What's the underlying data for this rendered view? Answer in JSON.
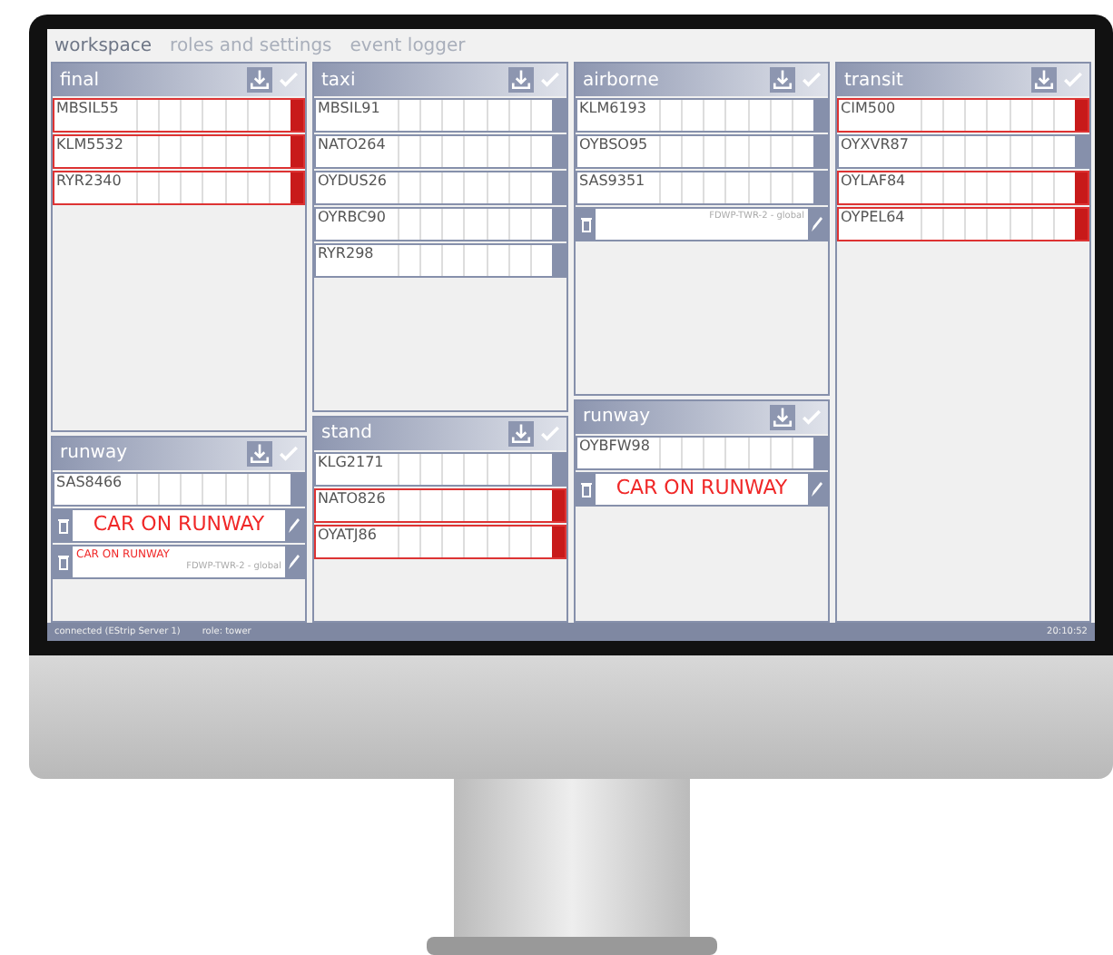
{
  "tabs": [
    {
      "label": "workspace",
      "selected": true
    },
    {
      "label": "roles and settings",
      "selected": false
    },
    {
      "label": "event logger",
      "selected": false
    }
  ],
  "columns": [
    {
      "panels": [
        {
          "title": "final",
          "strips": [
            {
              "kind": "strip",
              "callsign": "MBSIL55",
              "alert": true
            },
            {
              "kind": "strip",
              "callsign": "KLM5532",
              "alert": true
            },
            {
              "kind": "strip",
              "callsign": "RYR2340",
              "alert": true
            }
          ]
        },
        {
          "title": "runway",
          "strips": [
            {
              "kind": "strip",
              "callsign": "SAS8466",
              "alert": false
            },
            {
              "kind": "banner",
              "text": "CAR ON RUNWAY"
            },
            {
              "kind": "note",
              "text": "CAR ON RUNWAY",
              "author": "FDWP-TWR-2 - global"
            }
          ]
        }
      ]
    },
    {
      "panels": [
        {
          "title": "taxi",
          "strips": [
            {
              "kind": "strip",
              "callsign": "MBSIL91",
              "alert": false
            },
            {
              "kind": "strip",
              "callsign": "NATO264",
              "alert": false
            },
            {
              "kind": "strip",
              "callsign": "OYDUS26",
              "alert": false
            },
            {
              "kind": "strip",
              "callsign": "OYRBC90",
              "alert": false
            },
            {
              "kind": "strip",
              "callsign": "RYR298",
              "alert": false
            }
          ]
        },
        {
          "title": "stand",
          "strips": [
            {
              "kind": "strip",
              "callsign": "KLG2171",
              "alert": false
            },
            {
              "kind": "strip",
              "callsign": "NATO826",
              "alert": true
            },
            {
              "kind": "strip",
              "callsign": "OYATJ86",
              "alert": true
            }
          ]
        }
      ]
    },
    {
      "panels": [
        {
          "title": "airborne",
          "strips": [
            {
              "kind": "strip",
              "callsign": "KLM6193",
              "alert": false
            },
            {
              "kind": "strip",
              "callsign": "OYBSO95",
              "alert": false
            },
            {
              "kind": "strip",
              "callsign": "SAS9351",
              "alert": false
            },
            {
              "kind": "note",
              "author": "FDWP-TWR-2 - global"
            }
          ]
        },
        {
          "title": "runway",
          "strips": [
            {
              "kind": "strip",
              "callsign": "OYBFW98",
              "alert": false
            },
            {
              "kind": "banner",
              "text": "CAR ON RUNWAY"
            }
          ]
        }
      ]
    },
    {
      "panels": [
        {
          "title": "transit",
          "strips": [
            {
              "kind": "strip",
              "callsign": "CIM500",
              "alert": true
            },
            {
              "kind": "strip",
              "callsign": "OYXVR87",
              "alert": false
            },
            {
              "kind": "strip",
              "callsign": "OYLAF84",
              "alert": true
            },
            {
              "kind": "strip",
              "callsign": "OYPEL64",
              "alert": true
            }
          ]
        }
      ]
    }
  ],
  "status_bar": {
    "connection": "connected (EStrip Server 1)",
    "role": "role: tower",
    "clock": "20:10:52"
  }
}
